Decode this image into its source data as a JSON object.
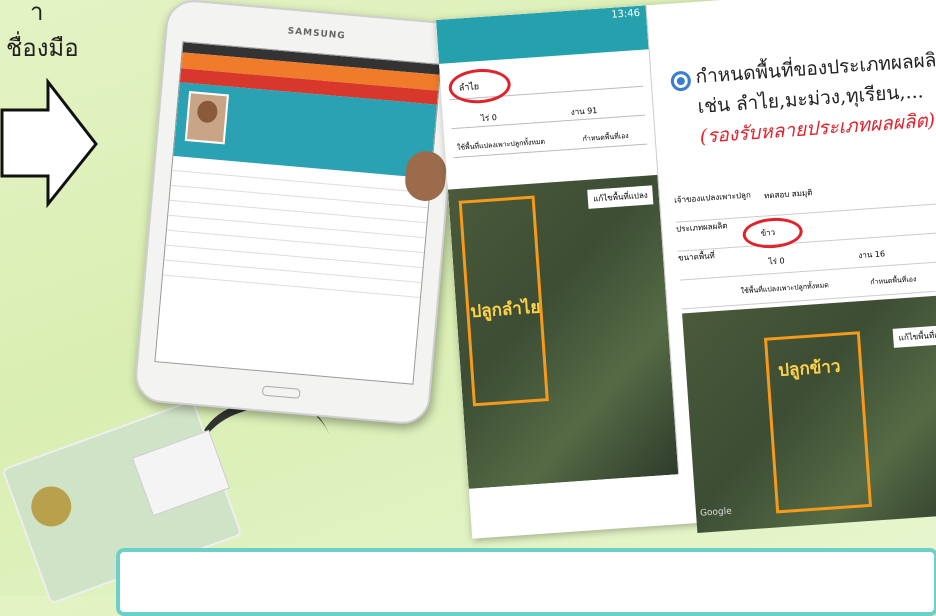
{
  "caption": {
    "line1": "า",
    "line2": "ชื่องมือ"
  },
  "tablet": {
    "brand": "SAMSUNG"
  },
  "screenshot": {
    "app": {
      "status_time": "13:46",
      "field_value_1": "ลำไย",
      "plot_label": "ปลูกลำไย",
      "button_label": "แก้ไขพื้นที่แปลง",
      "stepper_rai_label": "ไร่ 0",
      "stepper_ngan": "งาน 91",
      "option_label": "ใช้พื้นที่แปลงเพาะปลูกทั้งหมด",
      "option_selected": "กำหนดพื้นที่เอง"
    },
    "description": {
      "text": "กำหนดพื้นที่ของประเภทผลผลิต เช่น ลำไย,มะม่วง,ทุเรียน,...",
      "red_text": "(รองรับหลายประเภทผลผลิต)"
    },
    "form2": {
      "label_owner": "เจ้าของแปลงเพาะปลูก",
      "owner_value": "ทดสอบ สมมุติ",
      "label_type": "ประเภทผลผลิต",
      "type_value": "ข้าว",
      "label_size": "ขนาดพื้นที่",
      "rai": "ไร่ 0",
      "ngan": "งาน 16",
      "option_label": "ใช้พื้นที่แปลงเพาะปลูกทั้งหมด",
      "option_selected": "กำหนดพื้นที่เอง",
      "plot_label": "ปลูกข้าว",
      "button_label": "แก้ไขพื้นที่แปลง",
      "google": "Google"
    }
  },
  "colors": {
    "background": "#dff0bd",
    "accent_teal": "#25a1ad",
    "red_circle": "#e0222b",
    "plot_orange": "#f59a1b",
    "box_border": "#6dd0c8"
  }
}
